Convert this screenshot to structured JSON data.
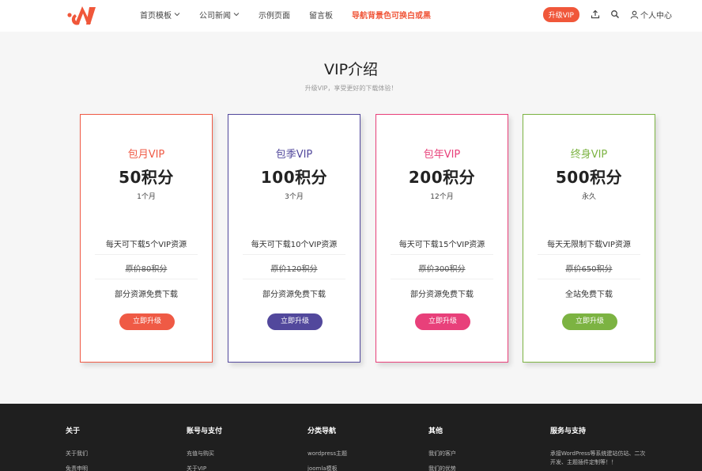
{
  "nav": {
    "items": [
      {
        "label": "首页模板",
        "dropdown": true
      },
      {
        "label": "公司新闻",
        "dropdown": true
      },
      {
        "label": "示例页面",
        "dropdown": false
      },
      {
        "label": "留言板",
        "dropdown": false
      },
      {
        "label": "导航背景色可换白或黑",
        "dropdown": false,
        "highlight": true
      }
    ],
    "vip_button": "升级VIP",
    "user_center": "个人中心"
  },
  "title": "VIP介绍",
  "subtitle": "升级VIP，享受更好的下载体验！",
  "cards": [
    {
      "name": "包月VIP",
      "price": "50积分",
      "period": "1个月",
      "feature1": "每天可下载5个VIP资源",
      "feature2": "原价80积分",
      "feature3": "部分资源免费下载",
      "button": "立即升级",
      "color": "#ef5a45"
    },
    {
      "name": "包季VIP",
      "price": "100积分",
      "period": "3个月",
      "feature1": "每天可下载10个VIP资源",
      "feature2": "原价120积分",
      "feature3": "部分资源免费下载",
      "button": "立即升级",
      "color": "#52489c"
    },
    {
      "name": "包年VIP",
      "price": "200积分",
      "period": "12个月",
      "feature1": "每天可下载15个VIP资源",
      "feature2": "原价300积分",
      "feature3": "部分资源免费下载",
      "button": "立即升级",
      "color": "#e8407a"
    },
    {
      "name": "终身VIP",
      "price": "500积分",
      "period": "永久",
      "feature1": "每天无限制下载VIP资源",
      "feature2": "原价650积分",
      "feature3": "全站免费下载",
      "button": "立即升级",
      "color": "#7cb342"
    }
  ],
  "footer": {
    "col1": {
      "title": "关于",
      "links": [
        "关于我们",
        "免责申明"
      ]
    },
    "col2": {
      "title": "账号与支付",
      "links": [
        "充值与购买",
        "关于VIP"
      ]
    },
    "col3": {
      "title": "分类导航",
      "links": [
        "wordpress主题",
        "joomla模板"
      ]
    },
    "col4": {
      "title": "其他",
      "links": [
        "我们的客户",
        "我们的优势"
      ]
    },
    "col5": {
      "title": "服务与支持",
      "desc": "承接WordPress等系统建站仿站、二次开发、主题插件定制等！！"
    }
  },
  "colors": {
    "accent": "#f0573a",
    "footer_bg": "#1f1f1f"
  }
}
